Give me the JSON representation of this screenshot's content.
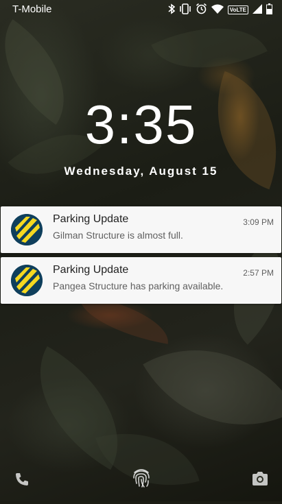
{
  "status_bar": {
    "carrier": "T-Mobile",
    "network_badge": "VoLTE",
    "icons": [
      "bluetooth-icon",
      "vibrate-icon",
      "alarm-icon",
      "wifi-icon",
      "volte-icon",
      "cell-signal-icon",
      "battery-icon"
    ]
  },
  "lockscreen": {
    "time": "3:35",
    "date": "Wednesday, August 15"
  },
  "notifications": [
    {
      "app_icon": "parking-app-icon",
      "title": "Parking Update",
      "text": "Gilman Structure is almost full.",
      "time": "3:09 PM"
    },
    {
      "app_icon": "parking-app-icon",
      "title": "Parking Update",
      "text": "Pangea Structure has parking available.",
      "time": "2:57 PM"
    }
  ],
  "bottom_shortcuts": {
    "left": "phone-icon",
    "center": "fingerprint-icon",
    "right": "camera-icon"
  },
  "colors": {
    "notification_background": "#f7f7f7",
    "app_icon_background": "#0f3f5c",
    "app_icon_stripes": "#f5d820"
  }
}
